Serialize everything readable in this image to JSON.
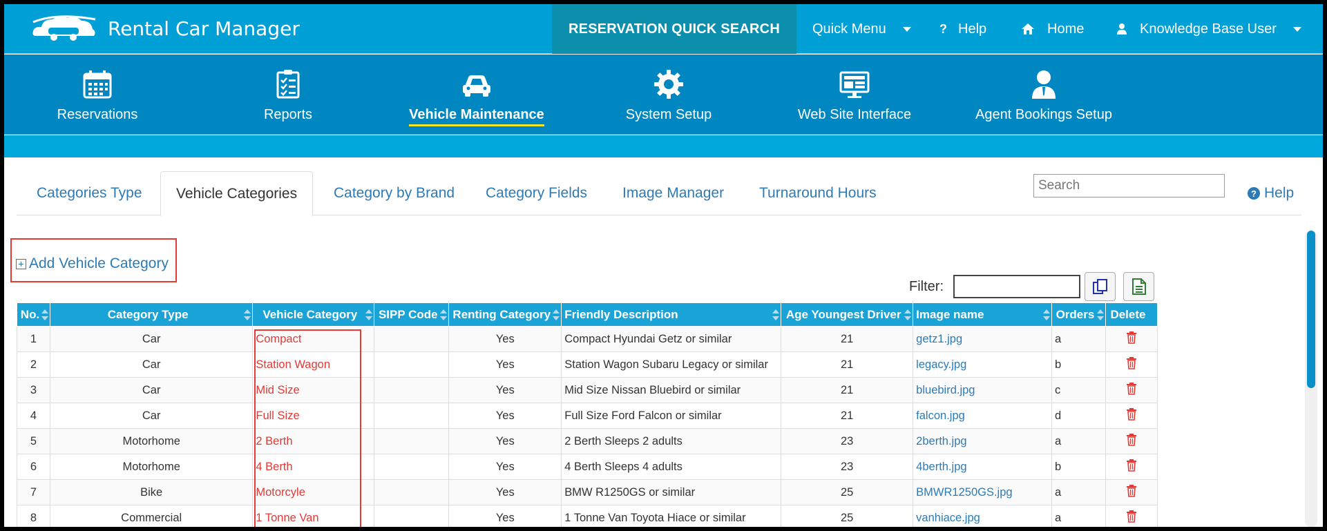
{
  "header": {
    "app_name": "Rental Car Manager",
    "quick_search": "RESERVATION QUICK SEARCH",
    "quick_menu": "Quick Menu",
    "help": "Help",
    "home": "Home",
    "user": "Knowledge Base User"
  },
  "modules": [
    {
      "label": "Reservations",
      "icon": "calendar-icon"
    },
    {
      "label": "Reports",
      "icon": "checklist-icon"
    },
    {
      "label": "Vehicle Maintenance",
      "icon": "car-icon",
      "active": true
    },
    {
      "label": "System Setup",
      "icon": "gear-icon"
    },
    {
      "label": "Web Site Interface",
      "icon": "monitor-icon"
    },
    {
      "label": "Agent Bookings Setup",
      "icon": "agent-icon"
    }
  ],
  "tabs": {
    "t0": "Categories Type",
    "t1": "Vehicle Categories",
    "t2": "Category by Brand",
    "t3": "Category Fields",
    "t4": "Image Manager",
    "t5": "Turnaround Hours",
    "active": "Vehicle Categories"
  },
  "search": {
    "placeholder": "Search"
  },
  "page_help": "Help",
  "add_category": "Add Vehicle Category",
  "filter": {
    "label": "Filter:",
    "value": ""
  },
  "table": {
    "headers": {
      "no": "No.",
      "type": "Category Type",
      "vcat": "Vehicle Category",
      "sipp": "SIPP Code",
      "renting": "Renting Category",
      "desc": "Friendly Description",
      "age": "Age Youngest Driver",
      "image": "Image name",
      "orders": "Orders",
      "delete": "Delete"
    },
    "rows": [
      {
        "no": "1",
        "type": "Car",
        "vcat": "Compact",
        "sipp": "",
        "renting": "Yes",
        "desc": "Compact Hyundai Getz or similar",
        "age": "21",
        "image": "getz1.jpg",
        "orders": "a"
      },
      {
        "no": "2",
        "type": "Car",
        "vcat": "Station Wagon",
        "sipp": "",
        "renting": "Yes",
        "desc": "Station Wagon Subaru Legacy or similar",
        "age": "21",
        "image": "legacy.jpg",
        "orders": "b"
      },
      {
        "no": "3",
        "type": "Car",
        "vcat": "Mid Size",
        "sipp": "",
        "renting": "Yes",
        "desc": "Mid Size Nissan Bluebird or similar",
        "age": "21",
        "image": "bluebird.jpg",
        "orders": "c"
      },
      {
        "no": "4",
        "type": "Car",
        "vcat": "Full Size",
        "sipp": "",
        "renting": "Yes",
        "desc": "Full Size Ford Falcon or similar",
        "age": "21",
        "image": "falcon.jpg",
        "orders": "d"
      },
      {
        "no": "5",
        "type": "Motorhome",
        "vcat": "2 Berth",
        "sipp": "",
        "renting": "Yes",
        "desc": "2 Berth Sleeps 2 adults",
        "age": "23",
        "image": "2berth.jpg",
        "orders": "a"
      },
      {
        "no": "6",
        "type": "Motorhome",
        "vcat": "4 Berth",
        "sipp": "",
        "renting": "Yes",
        "desc": "4 Berth Sleeps 4 adults",
        "age": "23",
        "image": "4berth.jpg",
        "orders": "b"
      },
      {
        "no": "7",
        "type": "Bike",
        "vcat": "Motorcyle",
        "sipp": "",
        "renting": "Yes",
        "desc": "BMW R1250GS or similar",
        "age": "25",
        "image": "BMWR1250GS.jpg",
        "orders": "a"
      },
      {
        "no": "8",
        "type": "Commercial",
        "vcat": "1 Tonne Van",
        "sipp": "",
        "renting": "Yes",
        "desc": "1 Tonne Van Toyota Hiace or similar",
        "age": "25",
        "image": "vanhiace.jpg",
        "orders": "a"
      }
    ]
  },
  "colors": {
    "topbar": "#00a0d6",
    "modnav": "#0087c1",
    "accent_underline": "#f5e52a",
    "highlight_red": "#e53935",
    "link": "#2c7bb6"
  }
}
